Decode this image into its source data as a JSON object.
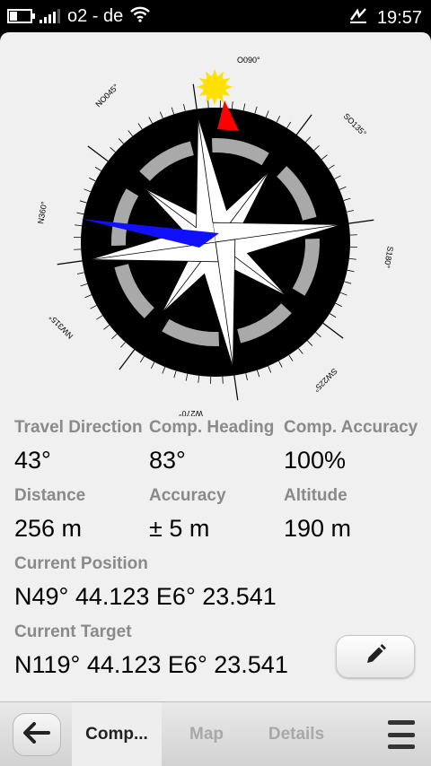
{
  "status_bar": {
    "carrier": "o2 - de",
    "time": "19:57",
    "battery_level": 0.35,
    "signal_bars": 4
  },
  "compass": {
    "labels": {
      "n": "N360°",
      "ne": "NO045°",
      "e": "O090°",
      "se": "SO135°",
      "s": "S180°",
      "sw": "SW225°",
      "w": "W270°",
      "nw": "NW315°"
    },
    "needle_color": "#1010ff",
    "target_color": "#ff0000",
    "sun_color": "#ffe000"
  },
  "info": {
    "travel_direction": {
      "label": "Travel Direction",
      "value": "43°"
    },
    "comp_heading": {
      "label": "Comp. Heading",
      "value": "83°"
    },
    "comp_accuracy": {
      "label": "Comp. Accuracy",
      "value": "100%"
    },
    "distance": {
      "label": "Distance",
      "value": "256 m"
    },
    "accuracy": {
      "label": "Accuracy",
      "value": "± 5 m"
    },
    "altitude": {
      "label": "Altitude",
      "value": "190 m"
    },
    "current_position": {
      "label": "Current Position",
      "value": "N49° 44.123 E6° 23.541"
    },
    "current_target": {
      "label": "Current Target",
      "value": "N119° 44.123 E6° 23.541"
    }
  },
  "toolbar": {
    "tabs": [
      {
        "label": "Comp...",
        "active": true
      },
      {
        "label": "Map",
        "active": false
      },
      {
        "label": "Details",
        "active": false
      }
    ]
  },
  "icons": {
    "back": "back-arrow-icon",
    "edit": "pencil-icon",
    "menu": "menu-icon"
  }
}
